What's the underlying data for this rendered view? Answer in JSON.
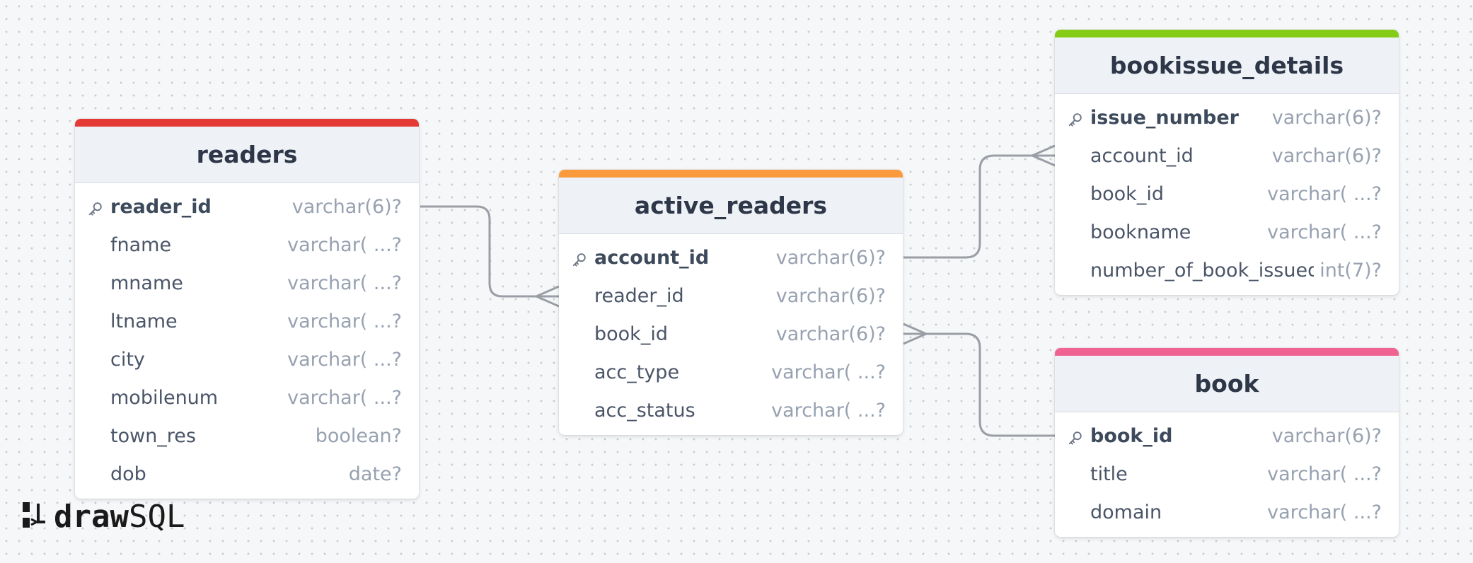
{
  "tables": {
    "readers": {
      "name": "readers",
      "accent": "#e53935",
      "columns": [
        {
          "name": "reader_id",
          "type": "varchar(6)?",
          "pk": true
        },
        {
          "name": "fname",
          "type": "varchar( ...?"
        },
        {
          "name": "mname",
          "type": "varchar( ...?"
        },
        {
          "name": "ltname",
          "type": "varchar( ...?"
        },
        {
          "name": "city",
          "type": "varchar( ...?"
        },
        {
          "name": "mobilenum",
          "type": "varchar( ...?"
        },
        {
          "name": "town_res",
          "type": "boolean?"
        },
        {
          "name": "dob",
          "type": "date?"
        }
      ]
    },
    "active_readers": {
      "name": "active_readers",
      "accent": "#fb9a3c",
      "columns": [
        {
          "name": "account_id",
          "type": "varchar(6)?",
          "pk": true
        },
        {
          "name": "reader_id",
          "type": "varchar(6)?"
        },
        {
          "name": "book_id",
          "type": "varchar(6)?"
        },
        {
          "name": "acc_type",
          "type": "varchar( ...?"
        },
        {
          "name": "acc_status",
          "type": "varchar( ...?"
        }
      ]
    },
    "bookissue_details": {
      "name": "bookissue_details",
      "accent": "#84cc16",
      "columns": [
        {
          "name": "issue_number",
          "type": "varchar(6)?",
          "pk": true
        },
        {
          "name": "account_id",
          "type": "varchar(6)?"
        },
        {
          "name": "book_id",
          "type": "varchar( ...?"
        },
        {
          "name": "bookname",
          "type": "varchar( ...?"
        },
        {
          "name": "number_of_book_issued",
          "type": "int(7)?"
        }
      ]
    },
    "book": {
      "name": "book",
      "accent": "#f06292",
      "columns": [
        {
          "name": "book_id",
          "type": "varchar(6)?",
          "pk": true
        },
        {
          "name": "title",
          "type": "varchar( ...?"
        },
        {
          "name": "domain",
          "type": "varchar( ...?"
        }
      ]
    }
  },
  "logo": {
    "bold": "draw",
    "light": "SQL"
  },
  "icons": {
    "primary_key": "key-icon",
    "logo": "drawsql-logo-icon"
  },
  "colors": {
    "relation_line": "#9a9ea6"
  }
}
